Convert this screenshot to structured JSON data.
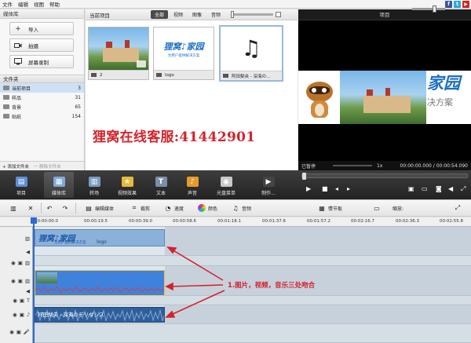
{
  "menu": [
    "文件",
    "编辑",
    "视图",
    "帮助"
  ],
  "social": [
    {
      "name": "facebook",
      "glyph": "f",
      "color": "#3b5998"
    },
    {
      "name": "twitter",
      "glyph": "t",
      "color": "#2fa9e0"
    },
    {
      "name": "youtube",
      "glyph": "▶",
      "color": "#d8231b"
    }
  ],
  "library": {
    "title": "媒体库",
    "buttons": [
      {
        "label": "导入",
        "icon": "plus-icon"
      },
      {
        "label": "拍摄",
        "icon": "camera-icon"
      },
      {
        "label": "屏幕录制",
        "icon": "screen-record-icon"
      }
    ],
    "folders_title": "文件夹",
    "folders": [
      {
        "name": "当前项目",
        "count": "3"
      },
      {
        "name": "样品",
        "count": "31"
      },
      {
        "name": "背景",
        "count": "65"
      },
      {
        "name": "贴纸",
        "count": "154"
      }
    ],
    "add_folder": "+ 添加文件夹",
    "delete_folder": "一 删除文件夹"
  },
  "project": {
    "title": "当前项目",
    "tabs": [
      "全部",
      "视频",
      "图像",
      "音频"
    ],
    "items": [
      {
        "caption": "2",
        "type": "video"
      },
      {
        "caption": "logo",
        "type": "image"
      },
      {
        "caption": "阿田梨央 - 深海の...",
        "type": "audio"
      }
    ],
    "logo_title": "狸窝♪家园",
    "logo_sub": "为用户提供解决方案"
  },
  "overlay_text": "狸窝在线客服:41442901",
  "preview": {
    "title": "项目",
    "brand_big": "家园",
    "brand_small": "决方案",
    "status": "已暂停",
    "speed": "1x",
    "time": "00:00:00.000 / 00:00:54.090"
  },
  "toolbar": [
    {
      "label": "项目",
      "icon": "project-icon",
      "color": "#5b8fd6",
      "glyph": "🎬",
      "active": false
    },
    {
      "label": "媒体库",
      "icon": "media-library-icon",
      "color": "#7fa9d8",
      "glyph": "▦",
      "active": true
    },
    {
      "label": "转场",
      "icon": "transition-icon",
      "color": "#7b9bbf",
      "glyph": "▥",
      "active": false
    },
    {
      "label": "视频效果",
      "icon": "video-effects-icon",
      "color": "#e8b93a",
      "glyph": "★",
      "active": false
    },
    {
      "label": "文本",
      "icon": "text-icon",
      "color": "#7a8fa8",
      "glyph": "T",
      "active": false
    },
    {
      "label": "声音",
      "icon": "sound-icon",
      "color": "#e89a2a",
      "glyph": "♪",
      "active": false
    },
    {
      "label": "光盘菜单",
      "icon": "disc-menu-icon",
      "color": "#c9c9c9",
      "glyph": "◉",
      "active": false
    },
    {
      "label": "制作...",
      "icon": "produce-icon",
      "color": "#444",
      "glyph": "🎬",
      "active": false
    }
  ],
  "timeline_tools": [
    {
      "label": "",
      "icon": "film-icon"
    },
    {
      "label": "",
      "icon": "delete-icon"
    },
    {
      "label": "",
      "icon": "undo-icon"
    },
    {
      "label": "",
      "icon": "redo-icon"
    },
    {
      "label": "编辑媒体",
      "icon": "edit-media-icon"
    },
    {
      "label": "裁剪",
      "icon": "crop-icon"
    },
    {
      "label": "速度",
      "icon": "speed-icon"
    },
    {
      "label": "颜色",
      "icon": "color-icon"
    },
    {
      "label": "音频",
      "icon": "audio-icon"
    },
    {
      "label": "情节板",
      "icon": "storyboard-icon"
    },
    {
      "label": "缩放:",
      "icon": "zoom-icon"
    }
  ],
  "ruler": [
    "00:00:00.0",
    "00:00:19.5",
    "00:00:39.0",
    "00:00:58.6",
    "00:01:18.1",
    "00:01:37.6",
    "00:01:57.2",
    "00:02:16.7",
    "00:02:36.3",
    "00:02:55.8"
  ],
  "clips": {
    "image_name": "logo",
    "audio_name": "阿田梨央 - 深海のデリダシス"
  },
  "annotation": "1.图片，视频，音乐三处吻合"
}
